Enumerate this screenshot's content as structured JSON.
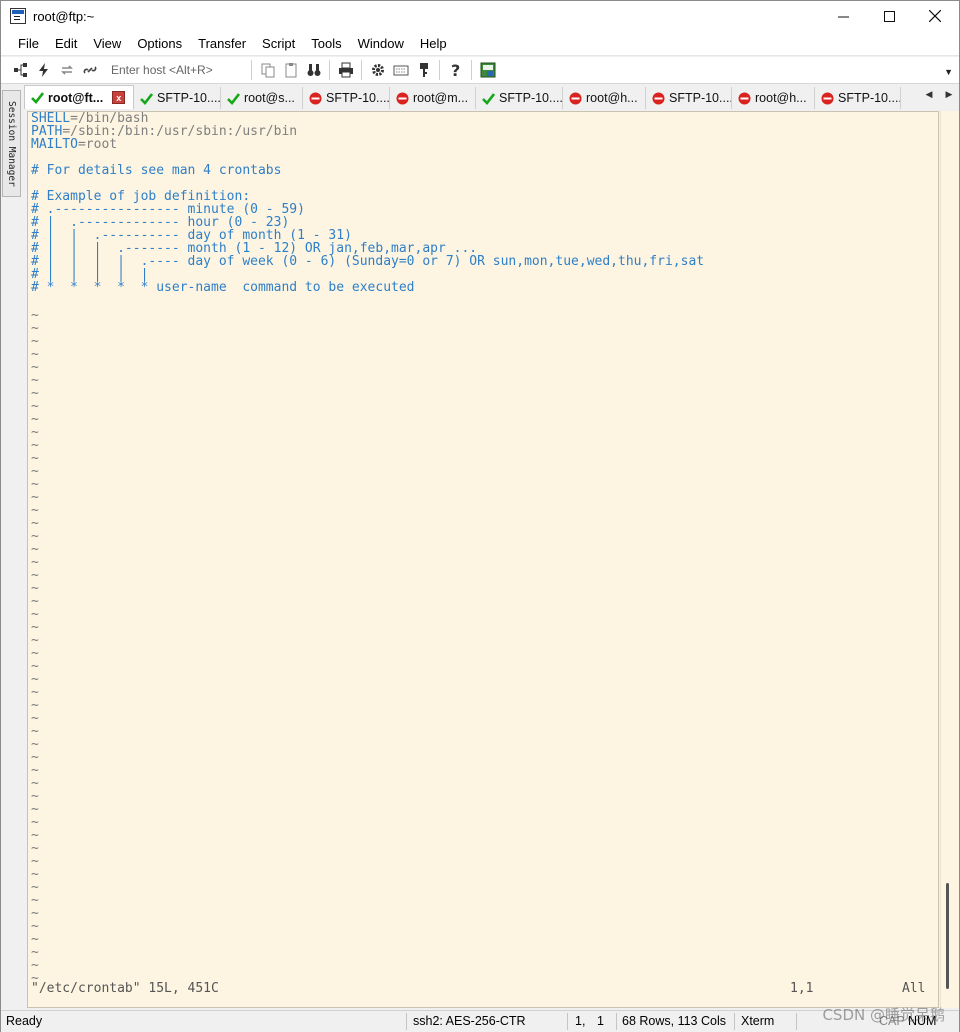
{
  "window": {
    "title": "root@ftp:~"
  },
  "menu": [
    "File",
    "Edit",
    "View",
    "Options",
    "Transfer",
    "Script",
    "Tools",
    "Window",
    "Help"
  ],
  "toolbar": {
    "host_placeholder": "Enter host <Alt+R>",
    "icons": [
      "connect-tree-icon",
      "quick-connect-icon",
      "reconnect-icon",
      "disconnect-icon",
      "copy-icon",
      "paste-icon",
      "find-icon",
      "print-icon",
      "session-options-icon",
      "keymap-icon",
      "key-agent-icon",
      "help-icon",
      "sftp-icon"
    ]
  },
  "session_manager": {
    "label": "Session Manager"
  },
  "tabs": [
    {
      "label": "root@ft...",
      "status": "connected",
      "active": true
    },
    {
      "label": "SFTP-10....",
      "status": "connected",
      "active": false
    },
    {
      "label": "root@s...",
      "status": "connected",
      "active": false
    },
    {
      "label": "SFTP-10....",
      "status": "disconnected",
      "active": false
    },
    {
      "label": "root@m...",
      "status": "disconnected",
      "active": false
    },
    {
      "label": "SFTP-10....",
      "status": "connected",
      "active": false
    },
    {
      "label": "root@h...",
      "status": "disconnected",
      "active": false
    },
    {
      "label": "SFTP-10....",
      "status": "disconnected",
      "active": false
    },
    {
      "label": "root@h...",
      "status": "disconnected",
      "active": false
    },
    {
      "label": "SFTP-10....",
      "status": "disconnected",
      "active": false
    }
  ],
  "colors": {
    "connected": "#16a819",
    "disconnected": "#d9231f",
    "terminal_bg": "#fdf5e2",
    "comment": "#2e7fc8",
    "value": "#7f7f7f"
  },
  "terminal": {
    "lines": [
      [
        {
          "t": "SHELL",
          "c": "blue"
        },
        {
          "t": "=/bin/bash",
          "c": "gray"
        }
      ],
      [
        {
          "t": "PATH",
          "c": "blue"
        },
        {
          "t": "=/sbin:/bin:/usr/sbin:/usr/bin",
          "c": "gray"
        }
      ],
      [
        {
          "t": "MAILTO",
          "c": "blue"
        },
        {
          "t": "=root",
          "c": "gray"
        }
      ],
      [],
      [
        {
          "t": "# For details see man 4 crontabs",
          "c": "blue"
        }
      ],
      [],
      [
        {
          "t": "# Example of job definition:",
          "c": "blue"
        }
      ],
      [
        {
          "t": "# .---------------- minute (0 - 59)",
          "c": "blue"
        }
      ],
      [
        {
          "t": "# |  .------------- hour (0 - 23)",
          "c": "blue"
        }
      ],
      [
        {
          "t": "# |  |  .---------- day of month (1 - 31)",
          "c": "blue"
        }
      ],
      [
        {
          "t": "# |  |  |  .------- month (1 - 12) OR jan,feb,mar,apr ...",
          "c": "blue"
        }
      ],
      [
        {
          "t": "# |  |  |  |  .---- day of week (0 - 6) (Sunday=0 or 7) OR sun,mon,tue,wed,thu,fri,sat",
          "c": "blue"
        }
      ],
      [
        {
          "t": "# |  |  |  |  |",
          "c": "blue"
        }
      ],
      [
        {
          "t": "# *  *  *  *  * user-name  command to be executed",
          "c": "blue"
        }
      ],
      []
    ],
    "tilde": "~",
    "tilde_count": 52,
    "status_file": "\"/etc/crontab\" 15L, 451C",
    "status_pos": "1,1",
    "status_scroll": "All"
  },
  "statusbar": {
    "ready": "Ready",
    "cipher": "ssh2: AES-256-CTR",
    "row": "1,",
    "col": "1",
    "size": "68 Rows, 113 Cols",
    "emulation": "Xterm",
    "caps": "CAP",
    "num": "NUM"
  },
  "watermark": "CSDN @睡觉呆鹅"
}
